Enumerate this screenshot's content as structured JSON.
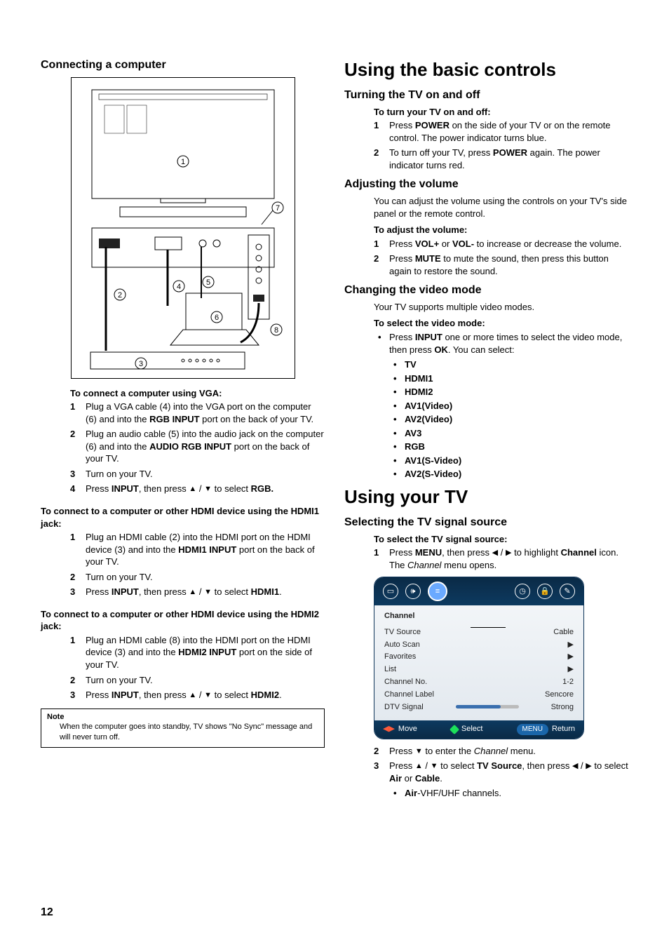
{
  "pageNumber": "12",
  "left": {
    "sectionTitle": "Connecting a computer",
    "vga": {
      "title": "To connect a computer using VGA:",
      "steps": [
        "Plug a VGA cable (4) into the VGA port on the computer (6) and into the <b>RGB INPUT</b> port on the back of your TV.",
        "Plug an audio cable (5) into the audio jack on the computer (6) and into the <b>AUDIO RGB INPUT</b> port on the back of your TV.",
        "Turn on your TV.",
        "Press <b>INPUT</b>, then press <span class='arrow tri-up'></span> / <span class='arrow tri-down'></span> to select <b>RGB.</b>"
      ]
    },
    "hdmi1": {
      "title": "To connect to a computer or other HDMI device using the HDMI1 jack:",
      "steps": [
        "Plug an HDMI cable (2) into the HDMI port on the HDMI device (3) and into the <b>HDMI1 INPUT</b> port on the back of your TV.",
        "Turn on your TV.",
        "Press <b>INPUT</b>, then press <span class='arrow tri-up'></span> / <span class='arrow tri-down'></span> to select <b>HDMI1</b>."
      ]
    },
    "hdmi2": {
      "title": "To connect to a computer or other HDMI device using the HDMI2 jack:",
      "steps": [
        "Plug an HDMI cable (8) into the HDMI port on the HDMI device (3) and into the <b>HDMI2 INPUT</b> port on the side of your TV.",
        "Turn on your TV.",
        "Press <b>INPUT</b>, then press <span class='arrow tri-up'></span> / <span class='arrow tri-down'></span> to select <b>HDMI2</b>."
      ]
    },
    "note": {
      "title": "Note",
      "body": "When the computer goes into standby, TV shows \"No Sync\" message and will never turn off."
    }
  },
  "right": {
    "main1": "Using the basic controls",
    "turning": {
      "title": "Turning the TV on and off",
      "stepTitle": "To turn your TV on and off:",
      "steps": [
        "Press <b>POWER</b> on the side of your TV or on the remote control. The power indicator turns blue.",
        "To turn off your TV, press <b>POWER</b> again. The power indicator turns red."
      ]
    },
    "volume": {
      "title": "Adjusting the volume",
      "intro": "You can adjust the volume using the controls on your TV's side panel or the remote control.",
      "stepTitle": "To adjust the volume:",
      "steps": [
        "Press <b>VOL+</b> or <b>VOL-</b> to increase or decrease the volume.",
        "Press <b>MUTE</b> to mute the sound, then press this button again to restore the sound."
      ]
    },
    "videoMode": {
      "title": "Changing the video mode",
      "intro": "Your TV supports multiple video modes.",
      "stepTitle": "To select the video mode:",
      "step1": "Press <b>INPUT</b> one or more times to select the video mode, then press <b>OK</b>. You can select:",
      "options": [
        "TV",
        "HDMI1",
        "HDMI2",
        "AV1(Video)",
        "AV2(Video)",
        "AV3",
        "RGB",
        "AV1(S-Video)",
        "AV2(S-Video)"
      ]
    },
    "main2": "Using your TV",
    "signal": {
      "title": "Selecting the TV signal source",
      "stepTitle": "To select the TV signal source:",
      "step1": "Press <b>MENU</b>, then press  <span class='arrow tri-left'></span> / <span class='arrow tri-right'></span>  to highlight <b>Channel</b> icon. The <i>Channel</i> menu opens.",
      "step2": "Press <span class='arrow tri-down'></span> to enter the <i>Channel</i> menu.",
      "step3": "Press <span class='arrow tri-up'></span> / <span class='arrow tri-down'></span> to select <b>TV Source</b>, then press <span class='arrow tri-left'></span> / <span class='arrow tri-right'></span>  to select <b>Air</b> or <b>Cable</b>.",
      "bullet": "<b>Air</b>-VHF/UHF channels."
    },
    "osd": {
      "title": "Channel",
      "rows": [
        {
          "l": "TV Source",
          "r": "Cable"
        },
        {
          "l": "Auto Scan",
          "r": "▶"
        },
        {
          "l": "Favorites",
          "r": "▶"
        },
        {
          "l": "List",
          "r": "▶"
        },
        {
          "l": "Channel No.",
          "r": "1-2"
        },
        {
          "l": "Channel Label",
          "r": "Sencore"
        },
        {
          "l": "DTV Signal",
          "r": "Strong",
          "bar": true
        }
      ],
      "footer": {
        "move": "Move",
        "select": "Select",
        "menu": "MENU",
        "ret": "Return"
      }
    }
  }
}
